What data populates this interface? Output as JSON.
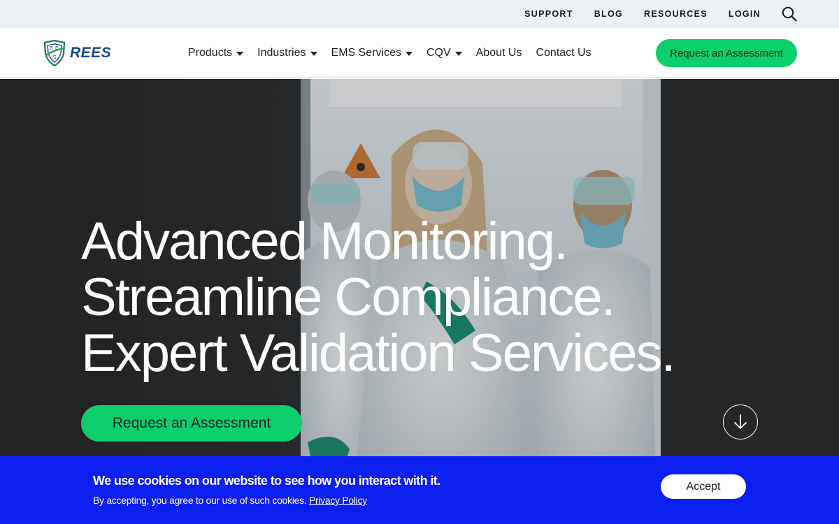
{
  "utility_bar": {
    "links": [
      "SUPPORT",
      "BLOG",
      "RESOURCES",
      "LOGIN"
    ],
    "search_icon": "search-icon"
  },
  "header": {
    "logo_text": "REES",
    "nav": [
      {
        "label": "Products",
        "has_dropdown": true
      },
      {
        "label": "Industries",
        "has_dropdown": true
      },
      {
        "label": "EMS Services",
        "has_dropdown": true
      },
      {
        "label": "CQV",
        "has_dropdown": true
      },
      {
        "label": "About Us",
        "has_dropdown": false
      },
      {
        "label": "Contact Us",
        "has_dropdown": false
      }
    ],
    "cta_label": "Request an Assessment"
  },
  "hero": {
    "title_lines": [
      "Advanced Monitoring.",
      "Streamline Compliance.",
      "Expert Validation Services."
    ],
    "cta_label": "Request an Assessment",
    "scroll_icon": "arrow-down-icon"
  },
  "cookie_banner": {
    "title": "We use cookies on our website to see how you interact with it.",
    "text": "By accepting, you agree to our use of such cookies.",
    "link_label": "Privacy Policy",
    "accept_label": "Accept"
  },
  "colors": {
    "accent_green": "#0bcf6c",
    "cookie_blue": "#0a1ff0",
    "brand_navy": "#164a8c"
  }
}
